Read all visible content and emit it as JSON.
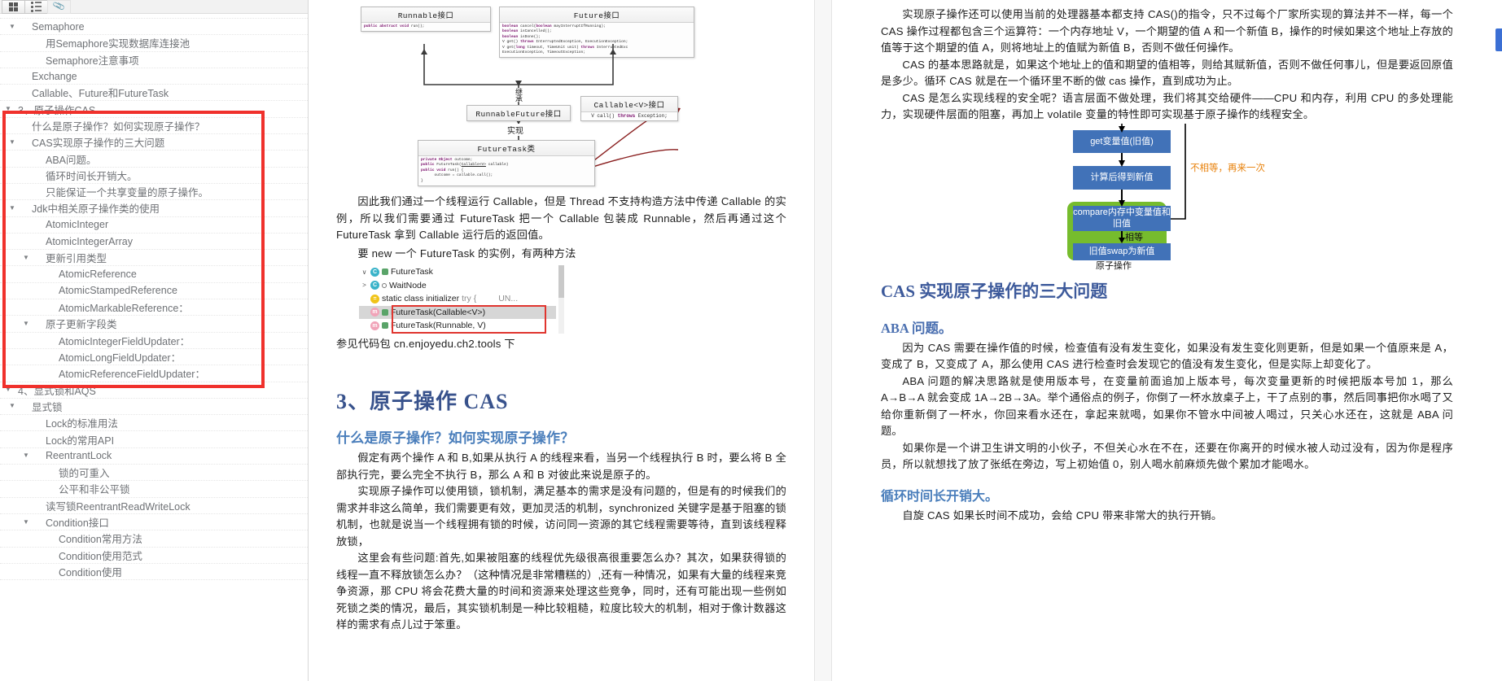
{
  "sidebar": {
    "toolbar": {
      "buttons": [
        {
          "name": "thumbnail-view-button",
          "icon": "grid-icon"
        },
        {
          "name": "outline-view-button",
          "icon": "list-icon"
        },
        {
          "name": "attachments-button",
          "icon": "paperclip-icon"
        }
      ]
    },
    "outline": [
      {
        "label": "Semaphore",
        "level": 2,
        "twisty": "▼"
      },
      {
        "label": "用Semaphore实现数据库连接池",
        "level": 3,
        "twisty": ""
      },
      {
        "label": "Semaphore注意事项",
        "level": 3,
        "twisty": ""
      },
      {
        "label": "Exchange",
        "level": 2,
        "twisty": ""
      },
      {
        "label": "Callable、Future和FutureTask",
        "level": 2,
        "twisty": ""
      },
      {
        "label": "3、原子操作CAS",
        "level": 1,
        "twisty": "▼"
      },
      {
        "label": "什么是原子操作？如何实现原子操作？",
        "level": 2,
        "twisty": ""
      },
      {
        "label": "CAS实现原子操作的三大问题",
        "level": 2,
        "twisty": "▼"
      },
      {
        "label": "ABA问题。",
        "level": 3,
        "twisty": ""
      },
      {
        "label": "循环时间长开销大。",
        "level": 3,
        "twisty": ""
      },
      {
        "label": "只能保证一个共享变量的原子操作。",
        "level": 3,
        "twisty": ""
      },
      {
        "label": "Jdk中相关原子操作类的使用",
        "level": 2,
        "twisty": "▼"
      },
      {
        "label": "AtomicInteger",
        "level": 3,
        "twisty": ""
      },
      {
        "label": "AtomicIntegerArray",
        "level": 3,
        "twisty": ""
      },
      {
        "label": "更新引用类型",
        "level": 3,
        "twisty": "▼"
      },
      {
        "label": "AtomicReference",
        "level": 4,
        "twisty": ""
      },
      {
        "label": "AtomicStampedReference",
        "level": 4,
        "twisty": ""
      },
      {
        "label": "AtomicMarkableReference：",
        "level": 4,
        "twisty": ""
      },
      {
        "label": "原子更新字段类",
        "level": 3,
        "twisty": "▼"
      },
      {
        "label": "AtomicIntegerFieldUpdater：",
        "level": 4,
        "twisty": ""
      },
      {
        "label": "AtomicLongFieldUpdater：",
        "level": 4,
        "twisty": ""
      },
      {
        "label": "AtomicReferenceFieldUpdater：",
        "level": 4,
        "twisty": ""
      },
      {
        "label": "4、显式锁和AQS",
        "level": 1,
        "twisty": "▼"
      },
      {
        "label": "显式锁",
        "level": 2,
        "twisty": "▼"
      },
      {
        "label": "Lock的标准用法",
        "level": 3,
        "twisty": ""
      },
      {
        "label": "Lock的常用API",
        "level": 3,
        "twisty": ""
      },
      {
        "label": "ReentrantLock",
        "level": 3,
        "twisty": "▼"
      },
      {
        "label": "锁的可重入",
        "level": 4,
        "twisty": ""
      },
      {
        "label": "公平和非公平锁",
        "level": 4,
        "twisty": ""
      },
      {
        "label": "读写锁ReentrantReadWriteLock",
        "level": 3,
        "twisty": ""
      },
      {
        "label": "Condition接口",
        "level": 3,
        "twisty": "▼"
      },
      {
        "label": "Condition常用方法",
        "level": 4,
        "twisty": ""
      },
      {
        "label": "Condition使用范式",
        "level": 4,
        "twisty": ""
      },
      {
        "label": "Condition使用",
        "level": 4,
        "twisty": ""
      }
    ],
    "annotation": {
      "name": "red-highlight-box",
      "color": "#f0312c"
    }
  },
  "middle_page": {
    "uml": {
      "boxes": [
        {
          "title": "Runnable接口",
          "lines": [
            "public abstract void run();"
          ]
        },
        {
          "title": "Future接口",
          "lines": [
            "boolean cancel(boolean mayInterruptIfRunning);",
            "boolean isCancelled();",
            "boolean isDone();",
            "V get() throws InterruptedException, ExecutionException;",
            "V get(long timeout, TimeUnit unit) throws  InterruptedException,",
            "ExecutionException, TimeoutException;"
          ]
        },
        {
          "title": "RunnableFuture接口",
          "lines": []
        },
        {
          "title": "Callable<V>接口",
          "lines": [
            "V call() throws Exception;"
          ]
        },
        {
          "title": "FutureTask类",
          "lines": [
            "private Object outcome;",
            "public FutureTask(Callable<V> callable)",
            "public void run() {",
            "        outcome = callable.call();",
            "}"
          ]
        }
      ],
      "edge_labels": [
        "继承",
        "实现"
      ]
    },
    "paragraphs": {
      "p1": "因此我们通过一个线程运行 Callable，但是 Thread 不支持构造方法中传递 Callable 的实例，所以我们需要通过 FutureTask 把一个 Callable 包装成 Runnable，然后再通过这个 FutureTask 拿到 Callable 运行后的返回值。",
      "p2": "要 new 一个 FutureTask 的实例，有两种方法",
      "p3": "参见代码包 cn.enjoyedu.ch2.tools 下"
    },
    "ide_tree": {
      "rows": [
        {
          "arrow": "∨",
          "icon": "class-icon",
          "icon_letter": "C",
          "sub": "bookmark-icon",
          "label": "FutureTask",
          "tail": "",
          "selected": false
        },
        {
          "arrow": ">",
          "icon": "class-icon",
          "icon_letter": "C",
          "sub": "circle-icon",
          "label": "WaitNode",
          "tail": "",
          "selected": false
        },
        {
          "arrow": "",
          "icon": "init-icon",
          "icon_letter": "=",
          "sub": "",
          "label": "static class initializer",
          "tail": "try {",
          "tail2": "UN...",
          "selected": false
        },
        {
          "arrow": "",
          "icon": "method-icon",
          "icon_letter": "m",
          "sub": "bookmark-icon",
          "label": "FutureTask(Callable<V>)",
          "tail": "",
          "selected": true
        },
        {
          "arrow": "",
          "icon": "method-icon",
          "icon_letter": "m",
          "sub": "bookmark-icon",
          "label": "FutureTask(Runnable, V)",
          "tail": "",
          "selected": false
        }
      ],
      "annotation_color": "#e0352f"
    },
    "headings": {
      "h_section": "3、原子操作 CAS",
      "h_sub": "什么是原子操作？如何实现原子操作？"
    },
    "body": {
      "b1": "假定有两个操作 A 和 B,如果从执行 A 的线程来看，当另一个线程执行 B 时，要么将 B 全部执行完，要么完全不执行 B，那么 A 和 B 对彼此来说是原子的。",
      "b2": "实现原子操作可以使用锁，锁机制，满足基本的需求是没有问题的，但是有的时候我们的需求并非这么简单，我们需要更有效，更加灵活的机制，synchronized 关键字是基于阻塞的锁机制，也就是说当一个线程拥有锁的时候，访问同一资源的其它线程需要等待，直到该线程释放锁，",
      "b3": "这里会有些问题:首先,如果被阻塞的线程优先级很高很重要怎么办？其次，如果获得锁的线程一直不释放锁怎么办？（这种情况是非常糟糕的）,还有一种情况，如果有大量的线程来竞争资源，那 CPU 将会花费大量的时间和资源来处理这些竞争，同时，还有可能出现一些例如死锁之类的情况，最后，其实锁机制是一种比较粗糙，粒度比较大的机制，相对于像计数器这样的需求有点儿过于笨重。"
    }
  },
  "right_page": {
    "body": {
      "r1": "实现原子操作还可以使用当前的处理器基本都支持 CAS()的指令，只不过每个厂家所实现的算法并不一样，每一个 CAS 操作过程都包含三个运算符：一个内存地址 V，一个期望的值 A 和一个新值 B，操作的时候如果这个地址上存放的值等于这个期望的值 A，则将地址上的值赋为新值 B，否则不做任何操作。",
      "r2": "CAS 的基本思路就是，如果这个地址上的值和期望的值相等，则给其赋新值，否则不做任何事儿，但是要返回原值是多少。循环 CAS 就是在一个循环里不断的做 cas 操作，直到成功为止。",
      "r3": "CAS 是怎么实现线程的安全呢？语言层面不做处理，我们将其交给硬件——CPU 和内存，利用 CPU 的多处理能力，实现硬件层面的阻塞，再加上 volatile 变量的特性即可实现基于原子操作的线程安全。"
    },
    "flowchart": {
      "nodes": [
        {
          "label": "get变量值(旧值)",
          "color": "#4172b8"
        },
        {
          "label": "计算后得到新值",
          "color": "#4172b8"
        },
        {
          "label": "compare内存中变量值和旧值",
          "color": "#4172b8"
        },
        {
          "label": "旧值swap为新值",
          "color": "#4172b8"
        }
      ],
      "group_label": "原子操作",
      "group_color": "#76bc2d",
      "edge_labels": [
        {
          "text": "不相等，再来一次",
          "color": "#e8820c"
        },
        {
          "text": "相等",
          "color": "#111111"
        }
      ]
    },
    "headings": {
      "h_main": "CAS 实现原子操作的三大问题",
      "h_aba": "ABA 问题。",
      "h_loop": "循环时间长开销大。"
    },
    "aba": {
      "a1": "因为 CAS 需要在操作值的时候，检查值有没有发生变化，如果没有发生变化则更新，但是如果一个值原来是 A，变成了 B，又变成了 A，那么使用 CAS 进行检查时会发现它的值没有发生变化，但是实际上却变化了。",
      "a2": "ABA 问题的解决思路就是使用版本号，在变量前面追加上版本号，每次变量更新的时候把版本号加 1，那么 A→B→A 就会变成 1A→2B→3A。举个通俗点的例子，你倒了一杯水放桌子上，干了点别的事，然后同事把你水喝了又给你重新倒了一杯水，你回来看水还在，拿起来就喝，如果你不管水中间被人喝过，只关心水还在，这就是 ABA 问题。",
      "a3": "如果你是一个讲卫生讲文明的小伙子，不但关心水在不在，还要在你离开的时候水被人动过没有，因为你是程序员，所以就想找了放了张纸在旁边，写上初始值 0，别人喝水前麻烦先做个累加才能喝水。",
      "a4": "自旋 CAS 如果长时间不成功，会给 CPU 带来非常大的执行开销。"
    }
  },
  "window": {
    "accent_tab_color": "#3b6fd4"
  }
}
